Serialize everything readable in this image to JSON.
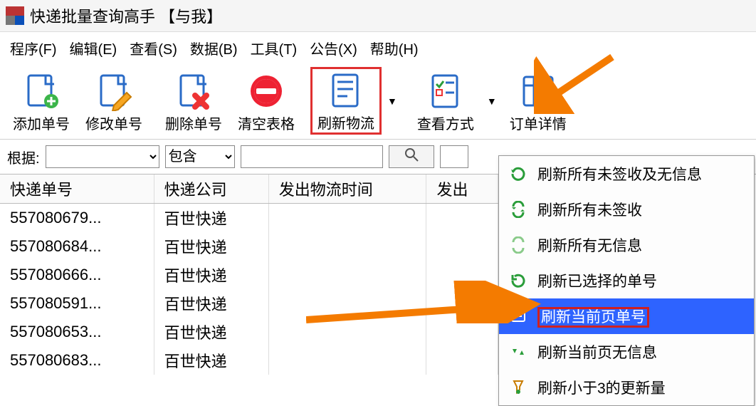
{
  "window": {
    "title": "快递批量查询高手 【与我】"
  },
  "menu": {
    "program": "程序(F)",
    "edit": "编辑(E)",
    "view": "查看(S)",
    "data": "数据(B)",
    "tool": "工具(T)",
    "notice": "公告(X)",
    "help": "帮助(H)"
  },
  "toolbar": {
    "add": "添加单号",
    "modify": "修改单号",
    "delete": "删除单号",
    "clear": "清空表格",
    "refresh": "刷新物流",
    "viewmode": "查看方式",
    "detail": "订单详情"
  },
  "filter": {
    "label": "根据:",
    "op": "包含"
  },
  "table": {
    "headers": {
      "trackno": "快递单号",
      "company": "快递公司",
      "sendtime": "发出物流时间",
      "sendloc": "发出"
    },
    "rows": [
      {
        "no": "557080679...",
        "co": "百世快递"
      },
      {
        "no": "557080684...",
        "co": "百世快递"
      },
      {
        "no": "557080666...",
        "co": "百世快递"
      },
      {
        "no": "557080591...",
        "co": "百世快递"
      },
      {
        "no": "557080653...",
        "co": "百世快递"
      },
      {
        "no": "557080683...",
        "co": "百世快递"
      }
    ]
  },
  "dropdown": {
    "items": [
      "刷新所有未签收及无信息",
      "刷新所有未签收",
      "刷新所有无信息",
      "刷新已选择的单号",
      "刷新当前页单号",
      "刷新当前页无信息",
      "刷新小于3的更新量"
    ],
    "selected_index": 4
  }
}
